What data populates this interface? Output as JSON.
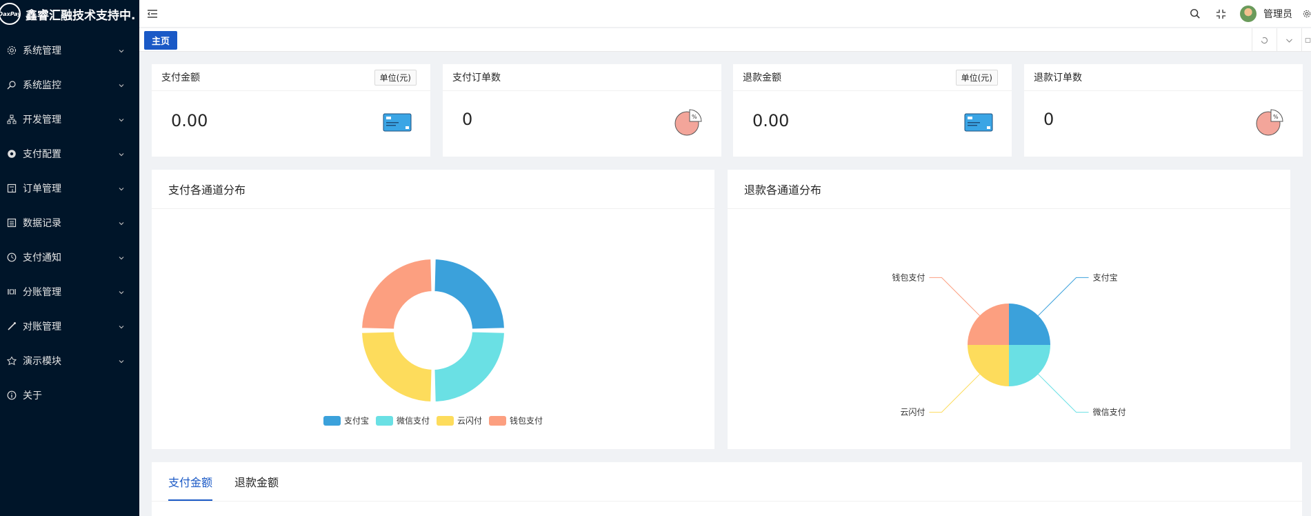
{
  "app": {
    "logo_text": "DaxPay",
    "title": "鑫睿汇融技术支持中..."
  },
  "sidebar": {
    "items": [
      {
        "label": "系统管理",
        "icon": "gear-icon",
        "has_children": true
      },
      {
        "label": "系统监控",
        "icon": "search-monitor-icon",
        "has_children": true
      },
      {
        "label": "开发管理",
        "icon": "sitemap-icon",
        "has_children": true
      },
      {
        "label": "支付配置",
        "icon": "setting-filled-icon",
        "has_children": true
      },
      {
        "label": "订单管理",
        "icon": "order-icon",
        "has_children": true
      },
      {
        "label": "数据记录",
        "icon": "list-icon",
        "has_children": true
      },
      {
        "label": "支付通知",
        "icon": "clock-icon",
        "has_children": true
      },
      {
        "label": "分账管理",
        "icon": "split-icon",
        "has_children": true
      },
      {
        "label": "对账管理",
        "icon": "reconcile-icon",
        "has_children": true
      },
      {
        "label": "演示模块",
        "icon": "demo-icon",
        "has_children": true
      },
      {
        "label": "关于",
        "icon": "info-icon",
        "has_children": false
      }
    ]
  },
  "header": {
    "username": "管理员"
  },
  "tabs": {
    "home": "主页"
  },
  "stats": [
    {
      "title": "支付金额",
      "unit": "单位(元)",
      "value": "0.00",
      "icon": "credit-card-icon"
    },
    {
      "title": "支付订单数",
      "unit": "",
      "value": "0",
      "icon": "pie-percent-icon"
    },
    {
      "title": "退款金额",
      "unit": "单位(元)",
      "value": "0.00",
      "icon": "credit-card-icon"
    },
    {
      "title": "退款订单数",
      "unit": "",
      "value": "0",
      "icon": "pie-percent-icon"
    }
  ],
  "colors": {
    "alipay": "#3ba1db",
    "wechat": "#6ae0e4",
    "unionpay": "#fddc5c",
    "wallet": "#fc9f80",
    "brand": "#1a59c6",
    "sidebar_bg": "#001529"
  },
  "panels": {
    "pay_title": "支付各通道分布",
    "refund_title": "退款各通道分布"
  },
  "chart_data": [
    {
      "type": "pie",
      "variant": "donut",
      "categories": [
        "支付宝",
        "微信支付",
        "云闪付",
        "钱包支付"
      ],
      "values": [
        1,
        1,
        1,
        1
      ],
      "legend": "bottom"
    },
    {
      "type": "pie",
      "categories": [
        "支付宝",
        "微信支付",
        "云闪付",
        "钱包支付"
      ],
      "values": [
        1,
        1,
        1,
        1
      ],
      "legend": "none"
    }
  ],
  "bottom_tabs": {
    "active": "支付金额",
    "other": "退款金额"
  }
}
